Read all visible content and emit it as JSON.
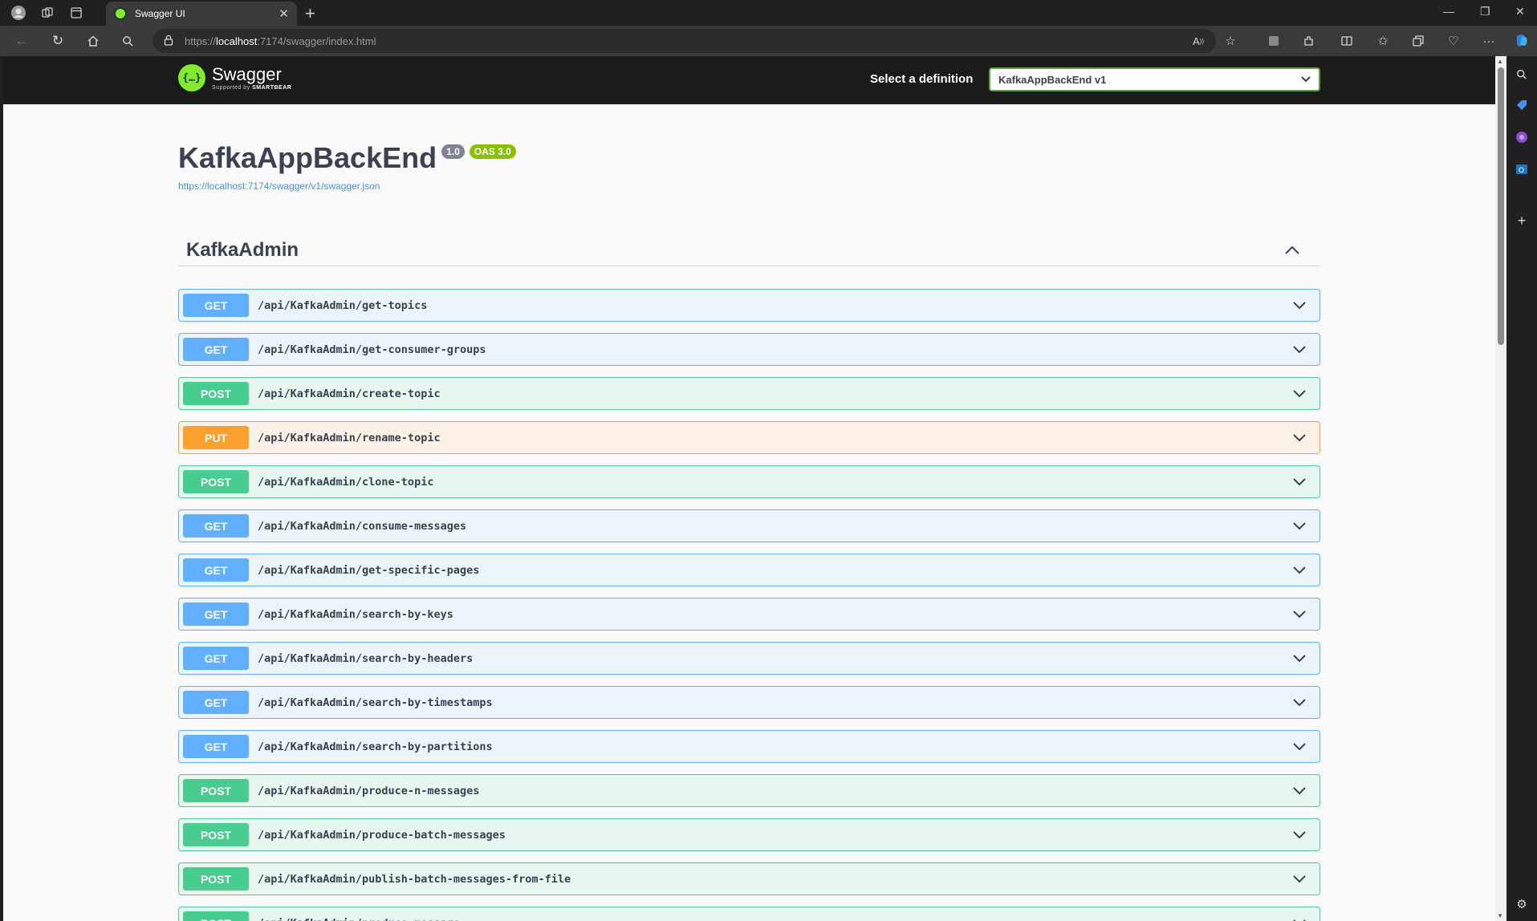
{
  "browser": {
    "tab_title": "Swagger UI",
    "url_scheme": "https://",
    "url_host": "localhost",
    "url_rest": ":7174/swagger/index.html"
  },
  "topbar": {
    "logo_name": "Swagger",
    "logo_sub_prefix": "Supported by ",
    "logo_sub_brand": "SMARTBEAR",
    "select_label": "Select a definition",
    "select_value": "KafkaAppBackEnd v1"
  },
  "info": {
    "title": "KafkaAppBackEnd",
    "version": "1.0",
    "oas": "OAS 3.0",
    "spec_url": "https://localhost:7174/swagger/v1/swagger.json"
  },
  "section": {
    "title": "KafkaAdmin",
    "operations": [
      {
        "method": "GET",
        "path": "/api/KafkaAdmin/get-topics"
      },
      {
        "method": "GET",
        "path": "/api/KafkaAdmin/get-consumer-groups"
      },
      {
        "method": "POST",
        "path": "/api/KafkaAdmin/create-topic"
      },
      {
        "method": "PUT",
        "path": "/api/KafkaAdmin/rename-topic"
      },
      {
        "method": "POST",
        "path": "/api/KafkaAdmin/clone-topic"
      },
      {
        "method": "GET",
        "path": "/api/KafkaAdmin/consume-messages"
      },
      {
        "method": "GET",
        "path": "/api/KafkaAdmin/get-specific-pages"
      },
      {
        "method": "GET",
        "path": "/api/KafkaAdmin/search-by-keys"
      },
      {
        "method": "GET",
        "path": "/api/KafkaAdmin/search-by-headers"
      },
      {
        "method": "GET",
        "path": "/api/KafkaAdmin/search-by-timestamps"
      },
      {
        "method": "GET",
        "path": "/api/KafkaAdmin/search-by-partitions"
      },
      {
        "method": "POST",
        "path": "/api/KafkaAdmin/produce-n-messages"
      },
      {
        "method": "POST",
        "path": "/api/KafkaAdmin/produce-batch-messages"
      },
      {
        "method": "POST",
        "path": "/api/KafkaAdmin/publish-batch-messages-from-file"
      },
      {
        "method": "POST",
        "path": "/api/KafkaAdmin/produce-message"
      }
    ]
  },
  "colors": {
    "get": "#61affe",
    "post": "#49cc90",
    "put": "#fca130",
    "swagger_green": "#85ea2d"
  }
}
